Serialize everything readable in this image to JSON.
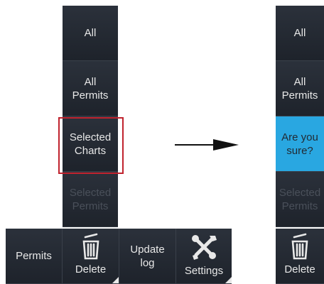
{
  "left_panel": {
    "menu": [
      {
        "label": "All",
        "enabled": true
      },
      {
        "label_line1": "All",
        "label_line2": "Permits",
        "enabled": true
      },
      {
        "label_line1": "Selected",
        "label_line2": "Charts",
        "enabled": true,
        "highlighted": true
      },
      {
        "label_line1": "Selected",
        "label_line2": "Permits",
        "enabled": false
      }
    ],
    "toolbar": {
      "permits_label": "Permits",
      "delete_label": "Delete",
      "update_log_line1": "Update",
      "update_log_line2": "log",
      "settings_label": "Settings"
    }
  },
  "right_panel": {
    "menu": [
      {
        "label": "All"
      },
      {
        "label_line1": "All",
        "label_line2": "Permits"
      },
      {
        "label_line1": "Are you",
        "label_line2": "sure?"
      },
      {
        "label_line1": "Selected",
        "label_line2": "Permits",
        "enabled": false
      }
    ],
    "toolbar": {
      "delete_label": "Delete"
    }
  },
  "colors": {
    "tile_dark": "#2b313b",
    "confirm_blue": "#29a7e1",
    "highlight_red": "#c0232e",
    "disabled_text": "#4a505a"
  }
}
